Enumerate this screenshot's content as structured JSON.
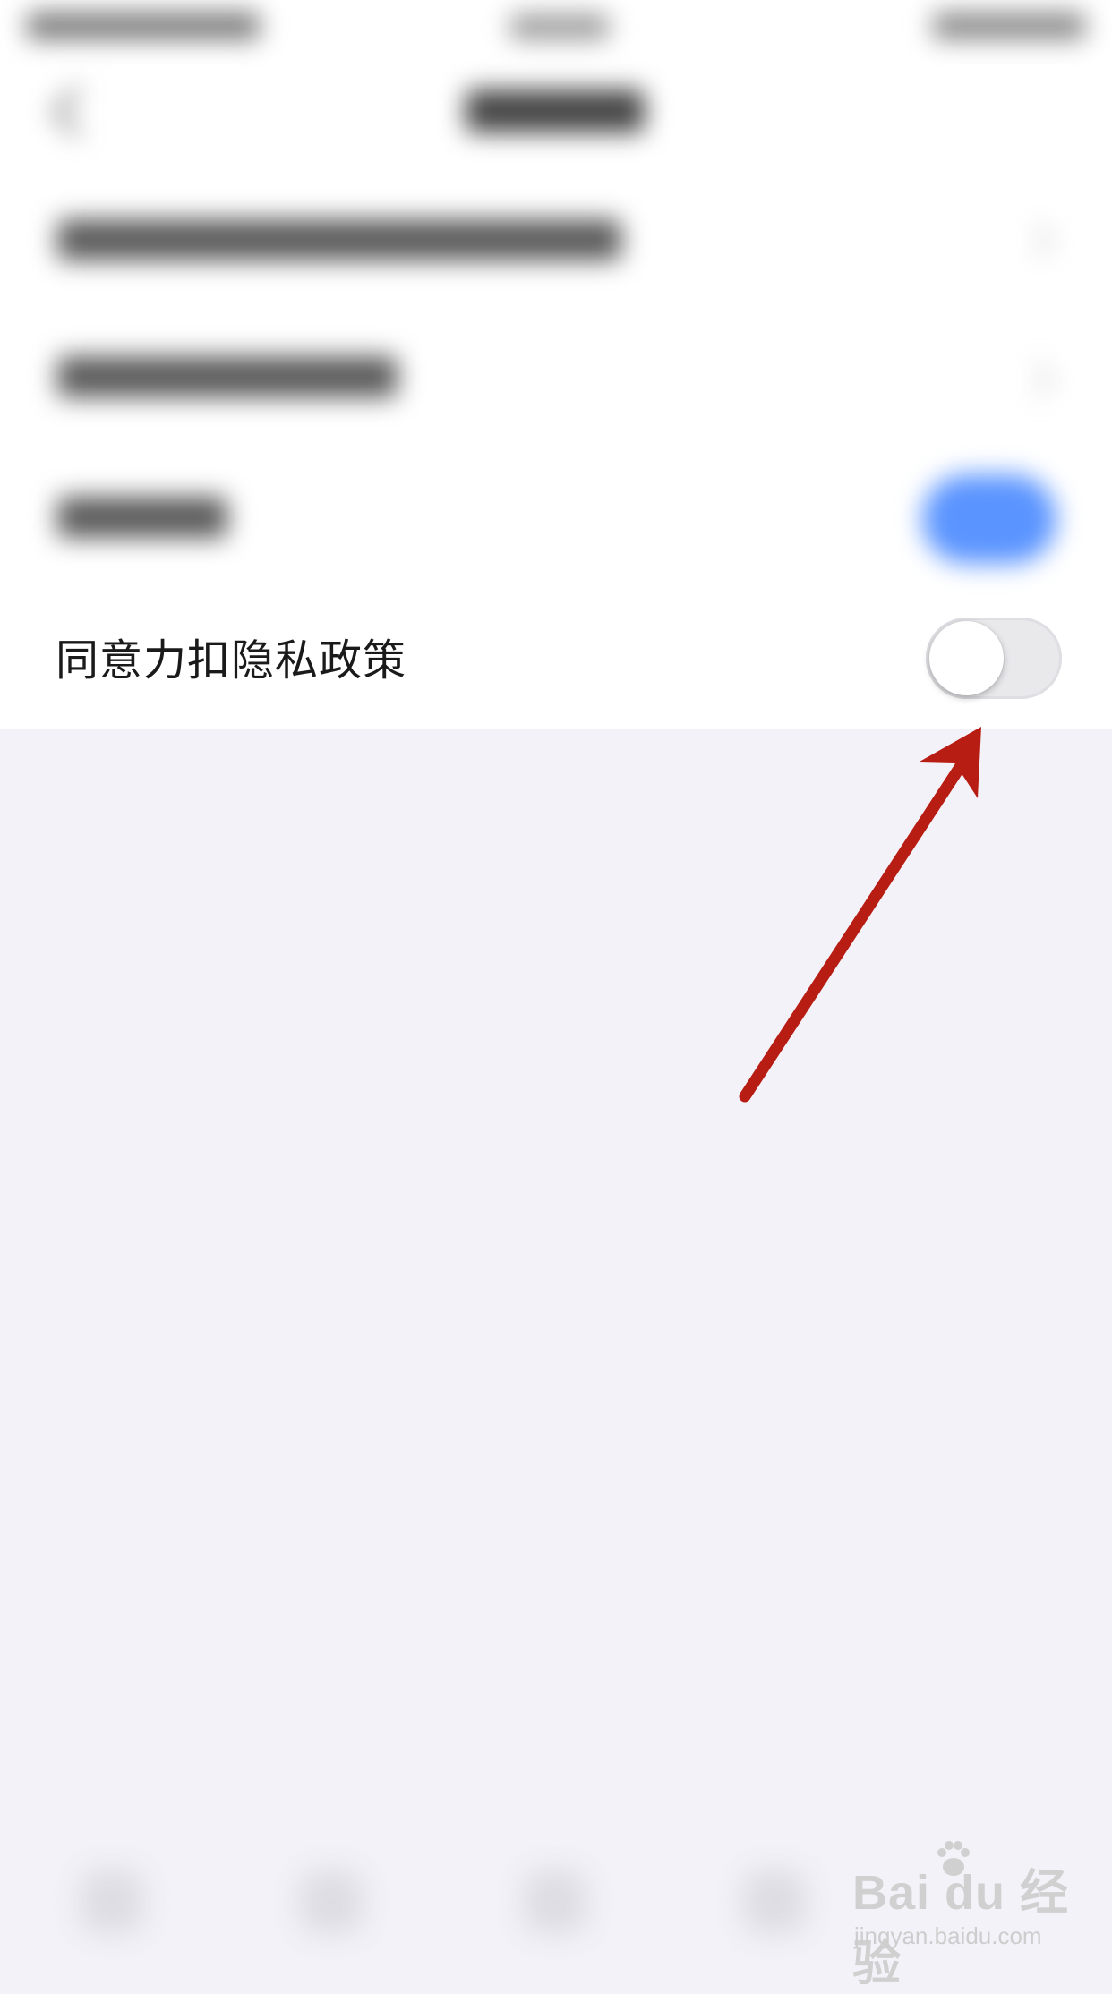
{
  "settings": {
    "privacy_label": "同意力扣隐私政策",
    "privacy_toggle_on": false
  },
  "colors": {
    "background": "#f3f2f8",
    "toggle_off": "#e9e9ec",
    "accent_blue": "#5a94ff",
    "annotation_arrow": "#b81d14"
  },
  "watermark": {
    "brand": "Bai du 经验",
    "url": "jingyan.baidu.com"
  }
}
